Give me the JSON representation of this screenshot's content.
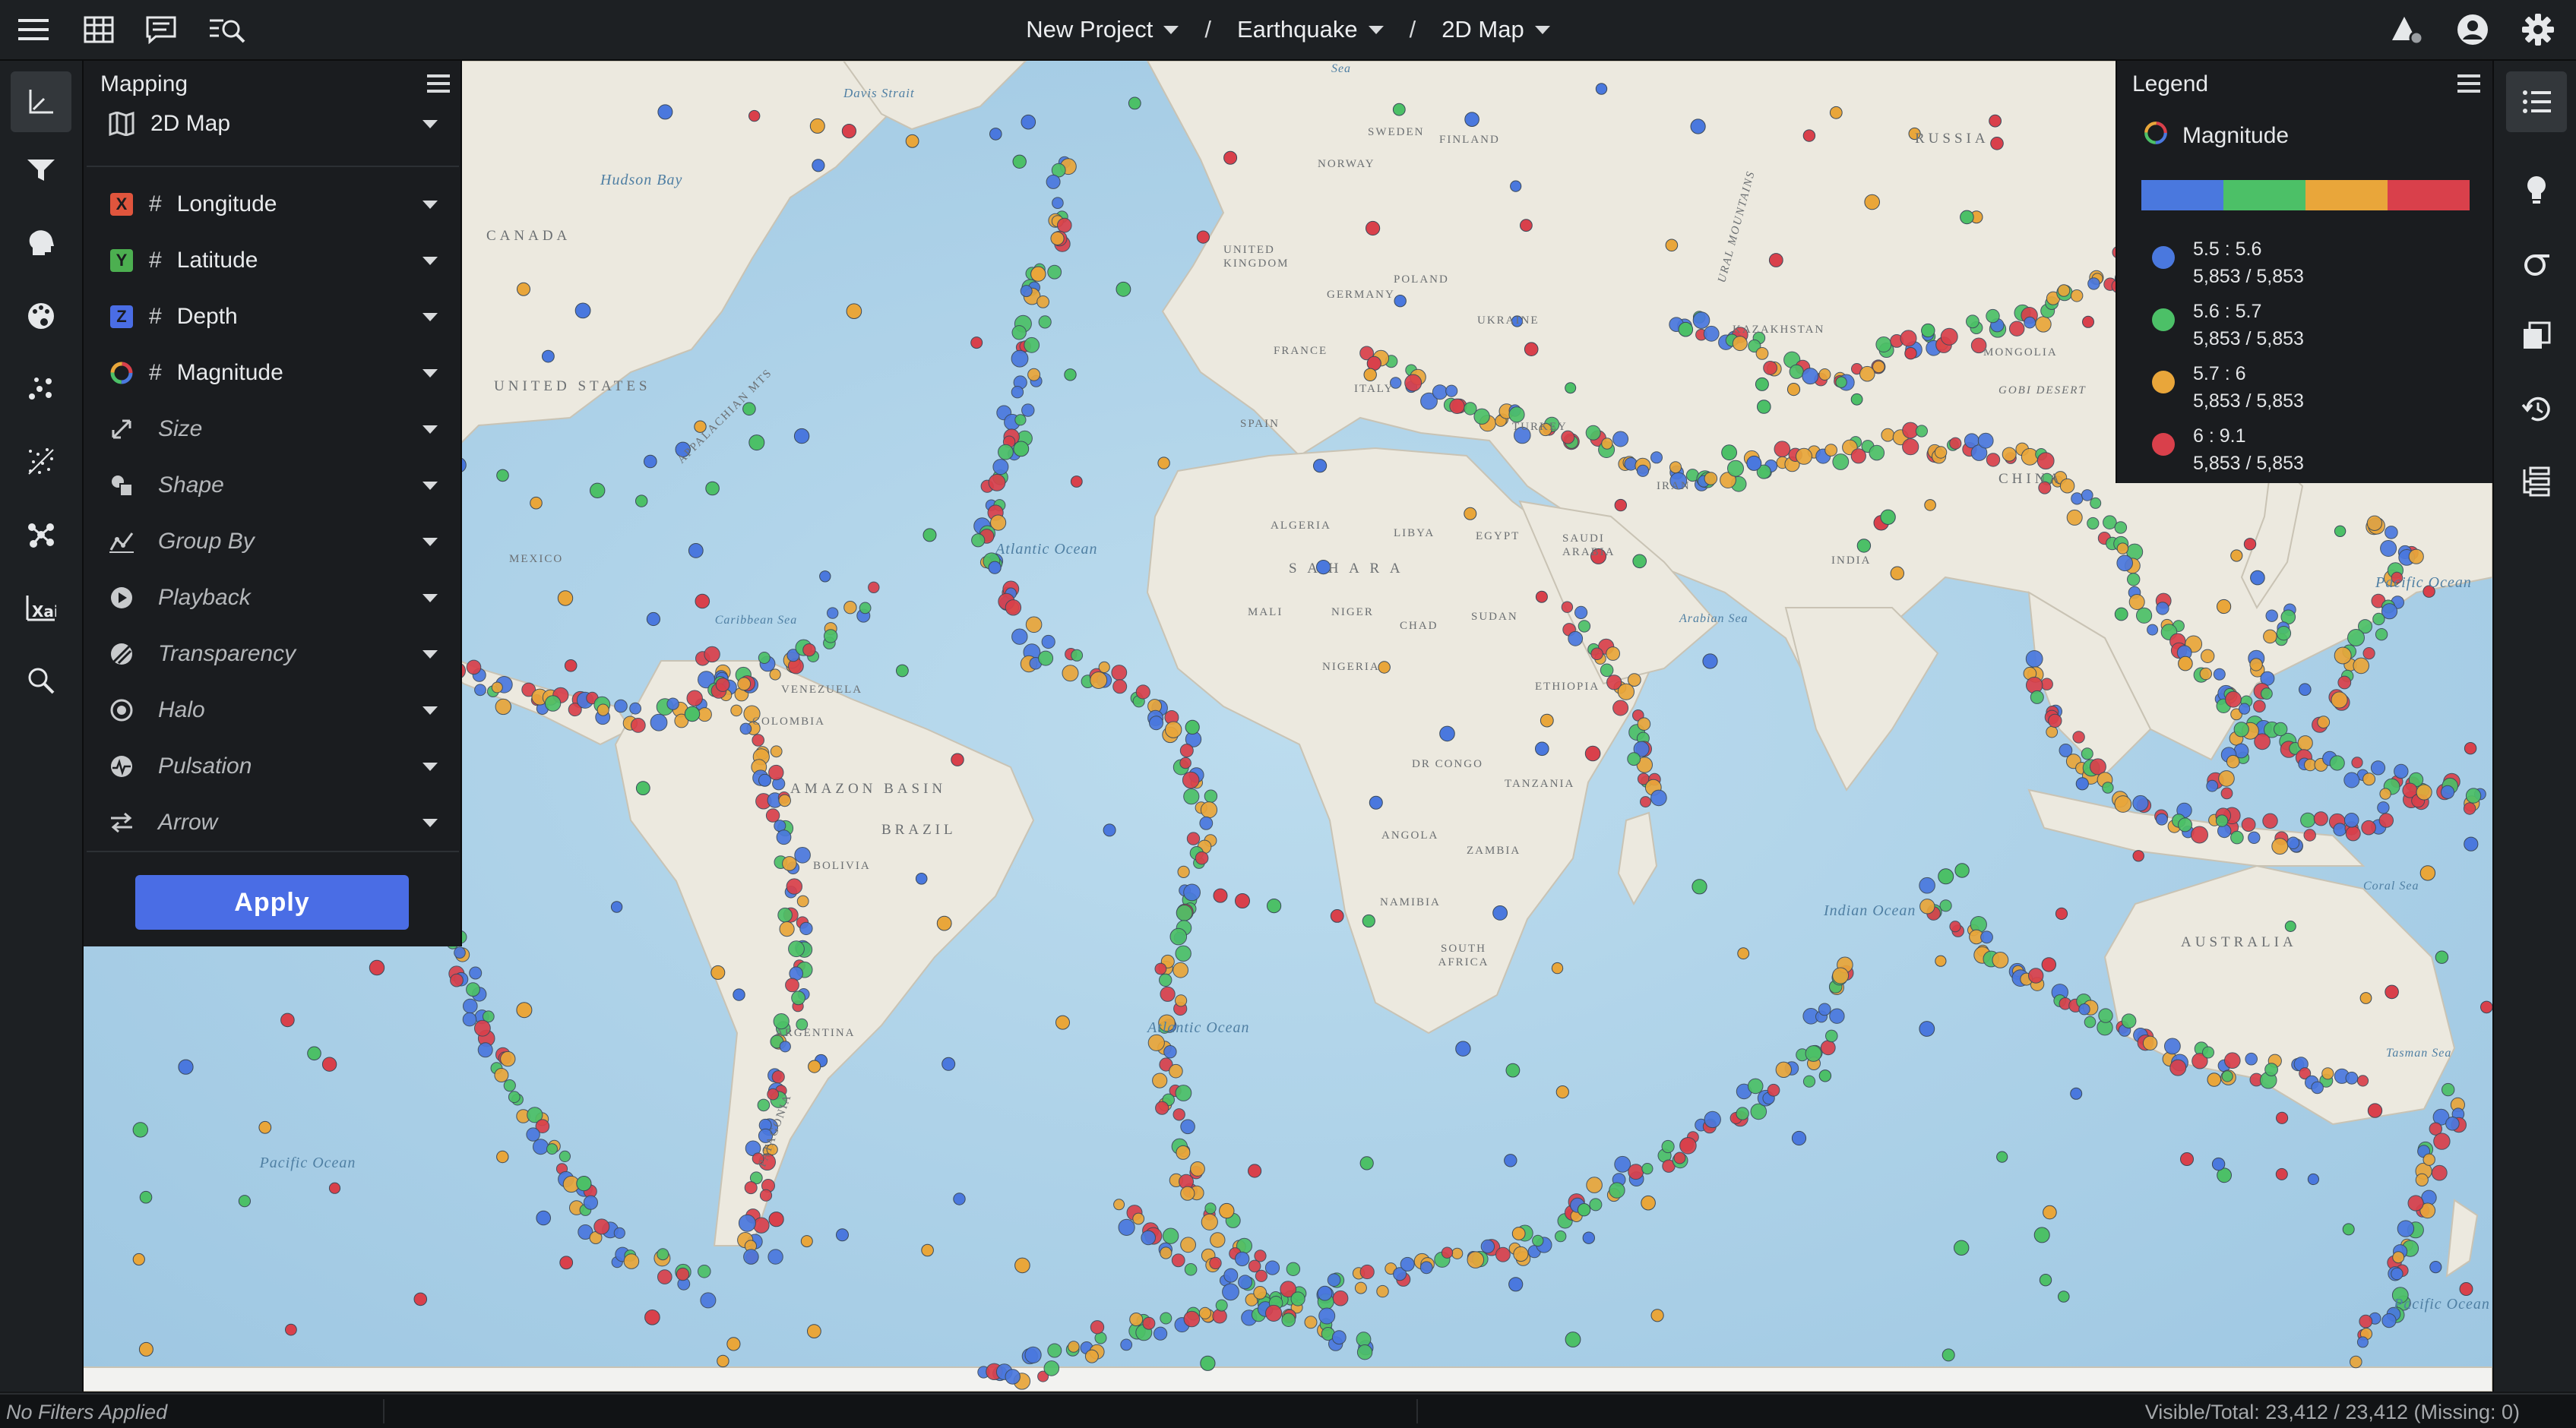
{
  "topbar": {
    "left_icons": [
      "hamburger-menu-icon",
      "table-icon",
      "notes-icon",
      "search-list-icon"
    ],
    "breadcrumbs": [
      {
        "label": "New Project"
      },
      {
        "label": "Earthquake"
      },
      {
        "label": "2D Map"
      }
    ],
    "separator": "/",
    "right_icons": [
      "alert-triangle-icon",
      "user-account-icon",
      "settings-gear-icon"
    ]
  },
  "left_rail": {
    "items": [
      "axes-mapping-icon",
      "filter-icon",
      "brain-icon",
      "palette-icon",
      "scatter-icon",
      "noise-icon",
      "network-icon",
      "xai-icon",
      "search-icon"
    ],
    "active": "axes-mapping-icon"
  },
  "right_rail": {
    "items": [
      "legend-list-icon",
      "lightbulb-icon",
      "sigma-icon",
      "copy-data-icon",
      "history-icon",
      "hierarchy-icon"
    ],
    "active": "legend-list-icon"
  },
  "mapping": {
    "title": "Mapping",
    "view_type": "2D Map",
    "fields": [
      {
        "badge": "X",
        "badge_color": "#e0553d",
        "label": "Longitude",
        "mapped": true
      },
      {
        "badge": "Y",
        "badge_color": "#4caf50",
        "label": "Latitude",
        "mapped": true
      },
      {
        "badge": "Z",
        "badge_color": "#4a6de5",
        "label": "Depth",
        "mapped": true
      },
      {
        "badge": "ring",
        "badge_color": "#e8a23a",
        "label": "Magnitude",
        "mapped": true
      },
      {
        "icon": "size-arrows-icon",
        "label": "Size",
        "mapped": false
      },
      {
        "icon": "shapes-icon",
        "label": "Shape",
        "mapped": false
      },
      {
        "icon": "group-by-icon",
        "label": "Group By",
        "mapped": false
      },
      {
        "icon": "play-circle-icon",
        "label": "Playback",
        "mapped": false
      },
      {
        "icon": "transparency-icon",
        "label": "Transparency",
        "mapped": false
      },
      {
        "icon": "halo-icon",
        "label": "Halo",
        "mapped": false
      },
      {
        "icon": "pulsation-icon",
        "label": "Pulsation",
        "mapped": false
      },
      {
        "icon": "arrow-icon",
        "label": "Arrow",
        "mapped": false
      }
    ],
    "hash_symbol": "#",
    "apply_label": "Apply"
  },
  "legend": {
    "title": "Legend",
    "field": "Magnitude",
    "colorbar": [
      "#4a78de",
      "#4cc067",
      "#e9a63a",
      "#d9404b"
    ],
    "items": [
      {
        "range": "5.5 : 5.6",
        "count": "5,853 / 5,853",
        "color": "#4a78de"
      },
      {
        "range": "5.6 : 5.7",
        "count": "5,853 / 5,853",
        "color": "#4cc067"
      },
      {
        "range": "5.7 : 6",
        "count": "5,853 / 5,853",
        "color": "#e9a63a"
      },
      {
        "range": "6 : 9.1",
        "count": "5,853 / 5,853",
        "color": "#d9404b"
      }
    ]
  },
  "map": {
    "labels": {
      "canada": "CANADA",
      "united_states": "UNITED STATES",
      "mexico": "MEXICO",
      "appalachian": "APPALACHIAN MTS",
      "hudson_bay": "Hudson Bay",
      "davis_strait": "Davis Strait",
      "caribbean": "Caribbean Sea",
      "venezuela": "VENEZUELA",
      "colombia": "COLOMBIA",
      "amazon_basin": "AMAZON BASIN",
      "brazil": "BRAZIL",
      "bolivia": "BOLIVIA",
      "argentina": "ARGENTINA",
      "patagonia": "PATAGONIA",
      "atlantic_ocean_n": "Atlantic Ocean",
      "atlantic_ocean_s": "Atlantic Ocean",
      "pacific_ocean_w": "Pacific Ocean",
      "pacific_ocean_e": "Pacific Ocean",
      "pacific_ocean_se": "Pacific Ocean",
      "indian_ocean": "Indian Ocean",
      "sweden": "SWEDEN",
      "norway": "NORWAY",
      "finland": "FINLAND",
      "russia": "RUSSIA",
      "united_kingdom": "UNITED KINGDOM",
      "germany": "GERMANY",
      "poland": "POLAND",
      "ukraine": "UKRAINE",
      "france": "FRANCE",
      "spain": "SPAIN",
      "italy": "ITALY",
      "turkey": "TURKEY",
      "iran": "IRAN",
      "kazakhstan": "KAZAKHSTAN",
      "mongolia": "MONGOLIA",
      "gobi_desert": "GOBI DESERT",
      "china": "CHINA",
      "india": "INDIA",
      "ural_mountains": "URAL MOUNTAINS",
      "algeria": "ALGERIA",
      "libya": "LIBYA",
      "egypt": "EGYPT",
      "saudi_arabia": "SAUDI ARABIA",
      "sahara": "S A H A R A",
      "mali": "MALI",
      "niger": "NIGER",
      "chad": "CHAD",
      "sudan": "SUDAN",
      "nigeria": "NIGERIA",
      "ethiopia": "ETHIOPIA",
      "dr_congo": "DR CONGO",
      "tanzania": "TANZANIA",
      "angola": "ANGOLA",
      "zambia": "ZAMBIA",
      "namibia": "NAMIBIA",
      "south_africa": "SOUTH AFRICA",
      "arabian_sea": "Arabian Sea",
      "australia": "AUSTRALIA",
      "coral_sea": "Coral Sea",
      "tasman_sea": "Tasman Sea",
      "sea": "Sea"
    }
  },
  "status": {
    "filters": "No Filters Applied",
    "visible_total": "Visible/Total: 23,412 / 23,412 (Missing: 0)"
  }
}
